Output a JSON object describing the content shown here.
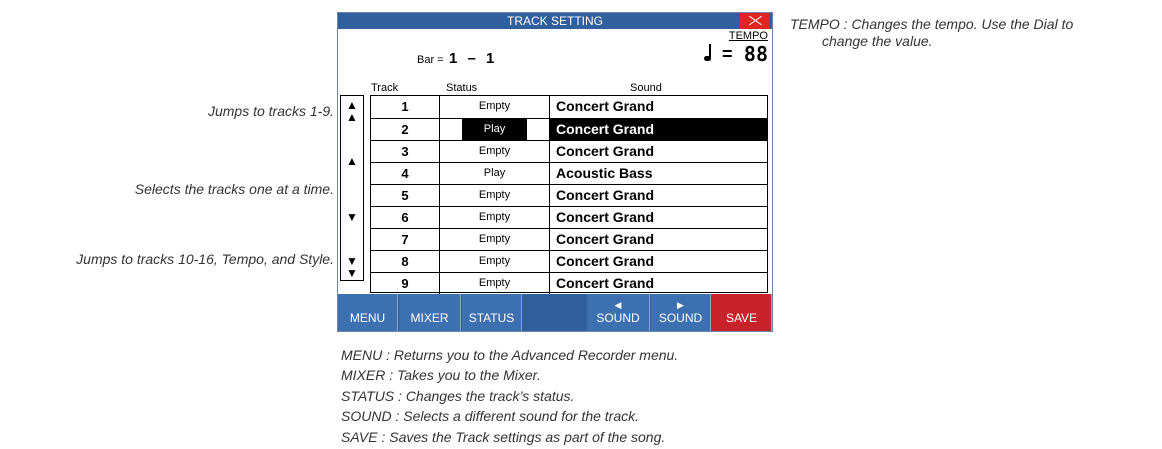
{
  "screen": {
    "title": "TRACK SETTING",
    "tempo_label": "TEMPO",
    "tempo_equals": "=",
    "tempo_value": "88",
    "bar_label": "Bar =",
    "bar_value": "1 – 1",
    "columns": {
      "track": "Track",
      "status": "Status",
      "sound": "Sound"
    },
    "rows": [
      {
        "track": "1",
        "status": "Empty",
        "sound": "Concert Grand",
        "selected": false
      },
      {
        "track": "2",
        "status": "Play",
        "sound": "Concert Grand",
        "selected": true
      },
      {
        "track": "3",
        "status": "Empty",
        "sound": "Concert Grand",
        "selected": false
      },
      {
        "track": "4",
        "status": "Play",
        "sound": "Acoustic Bass",
        "selected": false
      },
      {
        "track": "5",
        "status": "Empty",
        "sound": "Concert Grand",
        "selected": false
      },
      {
        "track": "6",
        "status": "Empty",
        "sound": "Concert Grand",
        "selected": false
      },
      {
        "track": "7",
        "status": "Empty",
        "sound": "Concert Grand",
        "selected": false
      },
      {
        "track": "8",
        "status": "Empty",
        "sound": "Concert Grand",
        "selected": false
      },
      {
        "track": "9",
        "status": "Empty",
        "sound": "Concert Grand",
        "selected": false
      }
    ],
    "buttons": {
      "menu": "MENU",
      "mixer": "MIXER",
      "status": "STATUS",
      "sound_prev": "SOUND",
      "sound_next": "SOUND",
      "save": "SAVE"
    },
    "icons": {
      "close": "close-icon",
      "scroll_top": "double-up-arrow-icon",
      "scroll_up": "up-arrow-icon",
      "scroll_down": "down-arrow-icon",
      "scroll_bottom": "double-down-arrow-icon",
      "note": "quarter-note-icon"
    }
  },
  "notes": {
    "tempo": "TEMPO  :  Changes the tempo. Use the Dial to",
    "tempo_cont": "change the value.",
    "jump_top": "Jumps to tracks 1-9.",
    "step": "Selects the tracks one at a time.",
    "jump_bottom": "Jumps to tracks 10-16, Tempo, and Style.",
    "menu": "MENU  :  Returns you to the Advanced Recorder menu.",
    "mixer": "MIXER  :  Takes you to the Mixer.",
    "status": "STATUS  :  Changes the track’s status.",
    "sound": "SOUND  :  Selects a different sound for the track.",
    "save": "SAVE  :  Saves the Track settings as part of the song."
  },
  "colors": {
    "titlebar": "#2f5f9c",
    "button": "#3c70b1",
    "save": "#c8232a",
    "close": "#e0241f"
  }
}
